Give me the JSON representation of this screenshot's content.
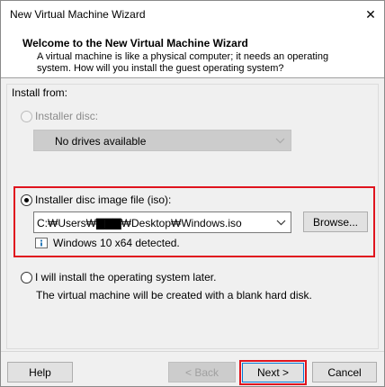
{
  "window": {
    "title": "New Virtual Machine Wizard",
    "close_glyph": "✕"
  },
  "header": {
    "title": "Welcome to the New Virtual Machine Wizard",
    "description": "A virtual machine is like a physical computer; it needs an operating system. How will you install the guest operating system?"
  },
  "install_from": {
    "label": "Install from:"
  },
  "installer_disc": {
    "label": "Installer disc:",
    "selected": false,
    "enabled": false,
    "dropdown_value": "No drives available"
  },
  "iso_option": {
    "label": "Installer disc image file (iso):",
    "selected": true,
    "path_value": "C:₩Users₩▇▇▇₩Desktop₩Windows.iso",
    "browse_label": "Browse...",
    "detected_text": "Windows 10 x64 detected."
  },
  "later_option": {
    "label": "I will install the operating system later.",
    "selected": false,
    "description": "The virtual machine will be created with a blank hard disk."
  },
  "footer": {
    "help_label": "Help",
    "back_label": "< Back",
    "next_label": "Next >",
    "cancel_label": "Cancel"
  },
  "colors": {
    "highlight": "#e0141e",
    "window_bg": "#f0f0f0",
    "header_bg": "#ffffff"
  }
}
